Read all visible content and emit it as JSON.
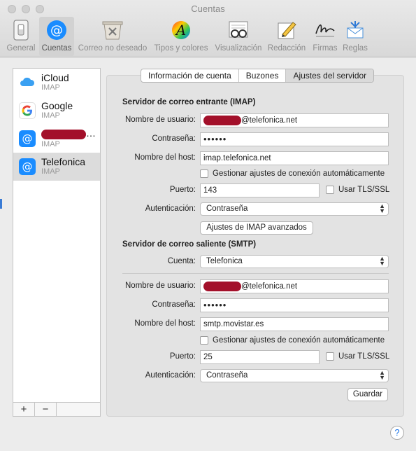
{
  "window": {
    "title": "Cuentas"
  },
  "toolbar": {
    "items": [
      {
        "label": "General",
        "icon": "switch-icon"
      },
      {
        "label": "Cuentas",
        "icon": "at-icon"
      },
      {
        "label": "Correo no deseado",
        "icon": "trash-bin-icon"
      },
      {
        "label": "Tipos y colores",
        "icon": "font-icon"
      },
      {
        "label": "Visualización",
        "icon": "glasses-icon"
      },
      {
        "label": "Redacción",
        "icon": "pencil-icon"
      },
      {
        "label": "Firmas",
        "icon": "signature-icon"
      },
      {
        "label": "Reglas",
        "icon": "rules-icon"
      }
    ]
  },
  "sidebar": {
    "accounts": [
      {
        "name": "iCloud",
        "type": "IMAP",
        "icon": "cloud-icon"
      },
      {
        "name": "Google",
        "type": "IMAP",
        "icon": "google-icon"
      },
      {
        "name": "…",
        "type": "IMAP",
        "icon": "at-icon"
      },
      {
        "name": "Telefonica",
        "type": "IMAP",
        "icon": "at-icon"
      }
    ],
    "add_label": "+",
    "remove_label": "−"
  },
  "tabs": [
    "Información de cuenta",
    "Buzones",
    "Ajustes del servidor"
  ],
  "incoming": {
    "section_title": "Servidor de correo entrante (IMAP)",
    "username_label": "Nombre de usuario:",
    "username_value": "@telefonica.net",
    "password_label": "Contraseña:",
    "password_value": "••••••",
    "host_label": "Nombre del host:",
    "host_value": "imap.telefonica.net",
    "auto_manage_label": "Gestionar ajustes de conexión automáticamente",
    "port_label": "Puerto:",
    "port_value": "143",
    "tls_label": "Usar TLS/SSL",
    "auth_label": "Autenticación:",
    "auth_value": "Contraseña",
    "advanced_button": "Ajustes de IMAP avanzados"
  },
  "outgoing": {
    "section_title": "Servidor de correo saliente (SMTP)",
    "account_label": "Cuenta:",
    "account_value": "Telefonica",
    "username_label": "Nombre de usuario:",
    "username_value": "@telefonica.net",
    "password_label": "Contraseña:",
    "password_value": "••••••",
    "host_label": "Nombre del host:",
    "host_value": "smtp.movistar.es",
    "auto_manage_label": "Gestionar ajustes de conexión automáticamente",
    "port_label": "Puerto:",
    "port_value": "25",
    "tls_label": "Usar TLS/SSL",
    "auth_label": "Autenticación:",
    "auth_value": "Contraseña",
    "save_button": "Guardar"
  },
  "help": {
    "label": "?"
  },
  "colors": {
    "accent": "#1a8cff",
    "redaction": "#a3102a"
  }
}
